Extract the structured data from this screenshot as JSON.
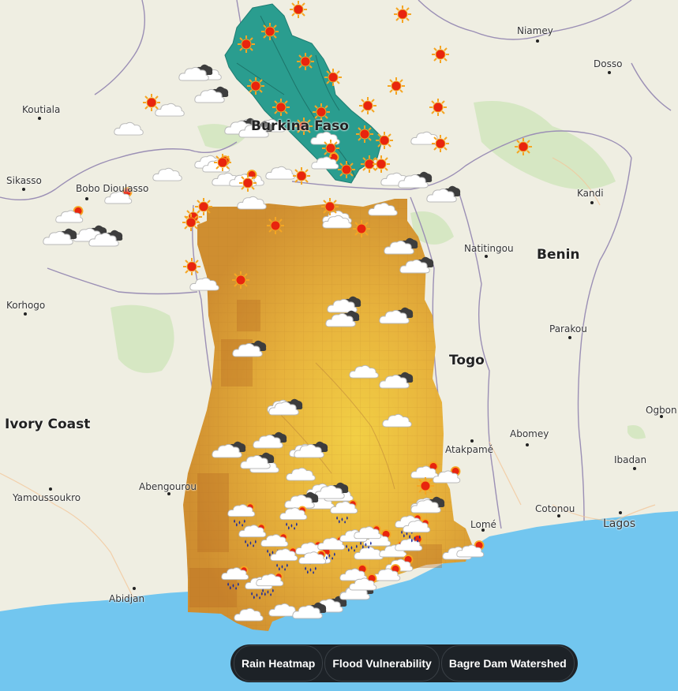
{
  "map": {
    "colors": {
      "land": "#efeee2",
      "water": "#72c6ef",
      "green": "#cfe3bd",
      "watershed": "#2a9d8f",
      "heat_light": "#f0c33c",
      "heat_dark": "#c47c2a",
      "border": "#9b8fb5"
    },
    "places": [
      {
        "name": "Niamey",
        "kind": "city"
      },
      {
        "name": "Dosso",
        "kind": "city"
      },
      {
        "name": "Koutiala",
        "kind": "city"
      },
      {
        "name": "Sikasso",
        "kind": "city"
      },
      {
        "name": "Bobo Dioulasso",
        "kind": "city"
      },
      {
        "name": "Burkina Faso",
        "kind": "country"
      },
      {
        "name": "Kandi",
        "kind": "city"
      },
      {
        "name": "Natitingou",
        "kind": "city"
      },
      {
        "name": "Benin",
        "kind": "country"
      },
      {
        "name": "Korhogo",
        "kind": "city"
      },
      {
        "name": "Parakou",
        "kind": "city"
      },
      {
        "name": "Togo",
        "kind": "country"
      },
      {
        "name": "Ivory Coast",
        "kind": "country"
      },
      {
        "name": "Ogbon",
        "kind": "city"
      },
      {
        "name": "Atakpamé",
        "kind": "city"
      },
      {
        "name": "Abomey",
        "kind": "city"
      },
      {
        "name": "Ibadan",
        "kind": "city"
      },
      {
        "name": "Abengourou",
        "kind": "city"
      },
      {
        "name": "Yamoussoukro",
        "kind": "city"
      },
      {
        "name": "Cotonou",
        "kind": "city"
      },
      {
        "name": "Lomé",
        "kind": "city"
      },
      {
        "name": "Lagos",
        "kind": "city"
      },
      {
        "name": "Abidjan",
        "kind": "city"
      }
    ],
    "weather_icons": [
      "sun-icon",
      "cloud-icon",
      "dark-cloud-icon",
      "partly-cloudy-icon",
      "rain-icon"
    ]
  },
  "controls": {
    "rain_heatmap": "Rain Heatmap",
    "flood_vulnerability": "Flood Vulnerability",
    "bagre_watershed": "Bagre Dam Watershed"
  }
}
